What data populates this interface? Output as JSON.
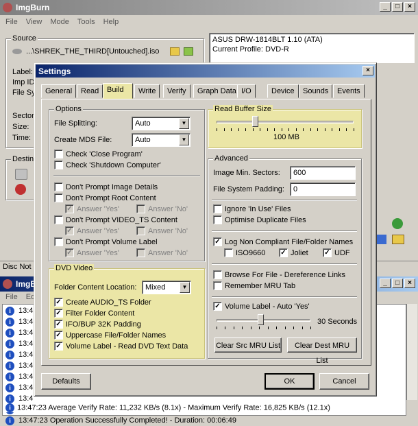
{
  "main_window": {
    "title": "ImgBurn",
    "menu": [
      "File",
      "View",
      "Mode",
      "Tools",
      "Help"
    ],
    "source_label": "Source",
    "source_path": "...\\SHREK_THE_THIRD[Untouched].iso",
    "info_labels": [
      "Label:",
      "Imp ID",
      "File Sy"
    ],
    "info_labels2": [
      "Sector",
      "Size:",
      "Time:"
    ],
    "destination_label": "Destin",
    "drive_name": "ASUS DRW-1814BLT 1.10 (ATA)",
    "current_profile": "Current Profile: DVD-R",
    "status_left": "Disc Not E"
  },
  "log_window": {
    "title": "ImgBu",
    "menu": [
      "File",
      "Ed"
    ],
    "lines": [
      "13:4",
      "13:4",
      "13:4",
      "13:4",
      "13:4",
      "13:4",
      "13:4",
      "13:4",
      "13:4",
      "13:4"
    ],
    "line_last1": "13:47:23 Operation Successfully Completed! - Duration: 00:06:49",
    "line_last2": "13:47:23 Average Verify Rate: 11,232 KB/s (8.1x) - Maximum Verify Rate: 16,825 KB/s (12.1x)"
  },
  "settings": {
    "title": "Settings",
    "tabs": [
      "General",
      "Read",
      "Build",
      "Write",
      "Verify",
      "Graph Data",
      "I/O",
      "Device",
      "Sounds",
      "Events"
    ],
    "options": {
      "title": "Options",
      "file_splitting_label": "File Splitting:",
      "file_splitting_value": "Auto",
      "create_mds_label": "Create MDS File:",
      "create_mds_value": "Auto",
      "check_close": "Check 'Close Program'",
      "check_shutdown": "Check 'Shutdown Computer'",
      "dont_prompt_image": "Don't Prompt Image Details",
      "dont_prompt_root": "Don't Prompt Root Content",
      "answer_yes": "Answer 'Yes'",
      "answer_no": "Answer 'No'",
      "dont_prompt_videots": "Don't Prompt VIDEO_TS Content",
      "dont_prompt_volume": "Don't Prompt Volume Label"
    },
    "dvd_video": {
      "title": "DVD Video",
      "folder_location_label": "Folder Content Location:",
      "folder_location_value": "Mixed",
      "items": [
        "Create AUDIO_TS Folder",
        "Filter Folder Content",
        "IFO/BUP 32K Padding",
        "Uppercase File/Folder Names",
        "Volume Label - Read DVD Text Data"
      ]
    },
    "read_buffer": {
      "title": "Read Buffer Size",
      "value_label": "100 MB",
      "level": 0.28
    },
    "advanced": {
      "title": "Advanced",
      "image_min_sectors_label": "Image Min. Sectors:",
      "image_min_sectors_value": "600",
      "fs_padding_label": "File System Padding:",
      "fs_padding_value": "0",
      "ignore_in_use": "Ignore 'In Use' Files",
      "optimise_dup": "Optimise Duplicate Files",
      "log_non_compliant": "Log Non Compliant File/Folder Names",
      "iso9660": "ISO9660",
      "joliet": "Joliet",
      "udf": "UDF",
      "browse_deref": "Browse For File - Dereference Links",
      "remember_mru": "Remember MRU Tab",
      "volume_label_auto": "Volume Label - Auto 'Yes'",
      "volume_timer_label": "30 Seconds",
      "volume_timer_level": 0.47,
      "clear_src": "Clear Src MRU List",
      "clear_dest": "Clear Dest MRU List"
    },
    "buttons": {
      "defaults": "Defaults",
      "ok": "OK",
      "cancel": "Cancel"
    }
  },
  "colors": {
    "highlight": "#ebe6a6",
    "titlebar_active": "#0a246a",
    "face": "#d4d0c8"
  }
}
